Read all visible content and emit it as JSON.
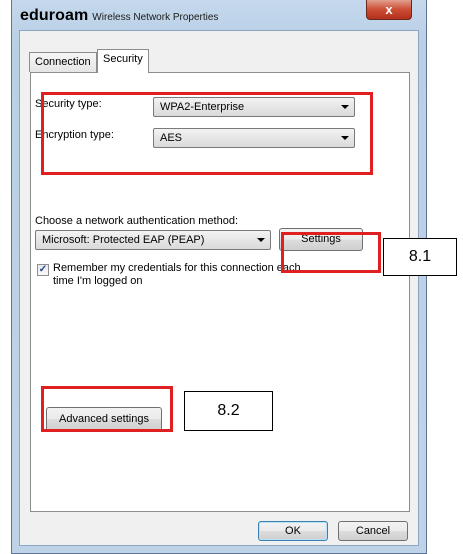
{
  "window": {
    "title_app": "eduroam",
    "title_sub": "Wireless Network Properties",
    "close_glyph": "x"
  },
  "tabs": [
    {
      "label": "Connection"
    },
    {
      "label": "Security"
    }
  ],
  "security": {
    "security_type_label": "Security type:",
    "security_type_value": "WPA2-Enterprise",
    "encryption_type_label": "Encryption type:",
    "encryption_type_value": "AES",
    "auth_method_label": "Choose a network authentication method:",
    "auth_method_value": "Microsoft: Protected EAP (PEAP)",
    "settings_button": "Settings",
    "remember_line1": "Remember my credentials for this connection each",
    "remember_line2": "time I'm logged on",
    "remember_checked": true,
    "remember_check_glyph": "✓",
    "advanced_button": "Advanced settings"
  },
  "footer": {
    "ok_button": "OK",
    "cancel_button": "Cancel"
  },
  "annotations": {
    "callout_settings": "8.1",
    "callout_advanced": "8.2",
    "highlight_color": "#e02020"
  }
}
